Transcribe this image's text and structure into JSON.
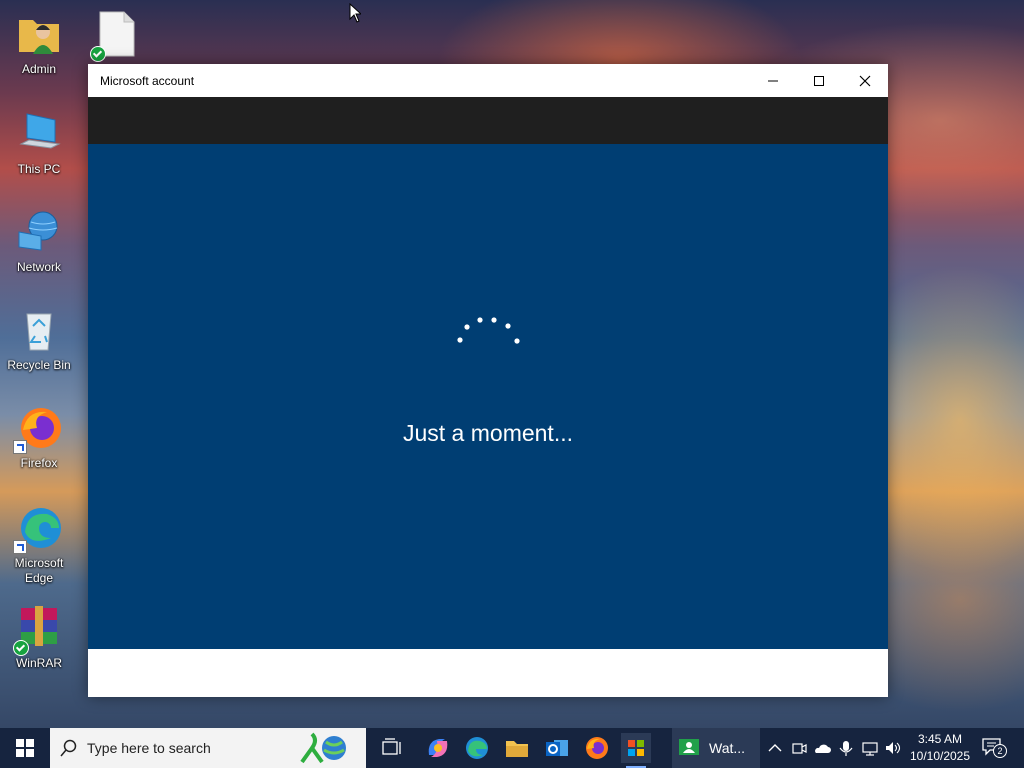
{
  "desktop": {
    "icons": [
      {
        "label": "Admin"
      },
      {
        "label": "This PC"
      },
      {
        "label": "Network"
      },
      {
        "label": "Recycle Bin"
      },
      {
        "label": "Firefox"
      },
      {
        "label": "Microsoft Edge"
      },
      {
        "label": "WinRAR"
      }
    ]
  },
  "window": {
    "title": "Microsoft account",
    "message": "Just a moment...",
    "background_color": "#003e73"
  },
  "taskbar": {
    "search_placeholder": "Type here to search",
    "active_app_label": "Wat...",
    "clock_time": "3:45 AM",
    "clock_date": "10/10/2025",
    "notification_count": "2",
    "color": "#16243f"
  }
}
